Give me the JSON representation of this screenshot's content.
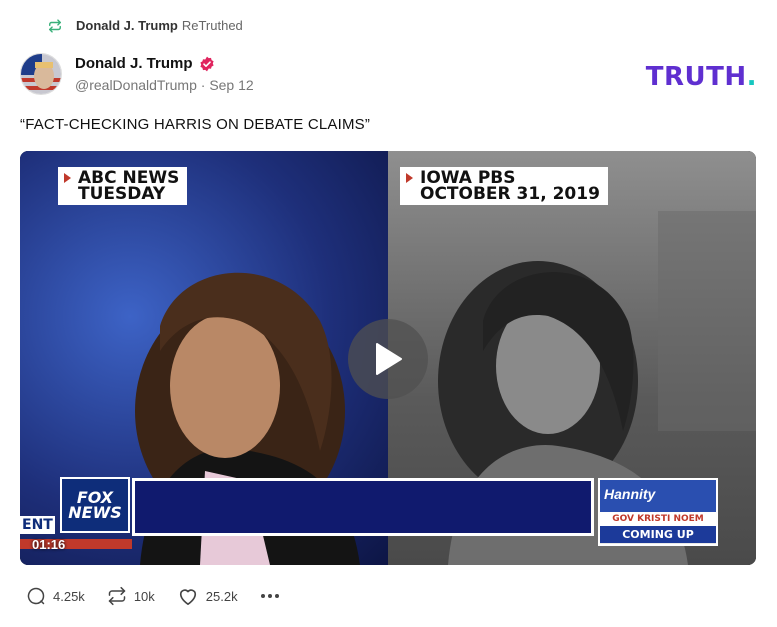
{
  "retruth": {
    "name": "Donald J. Trump",
    "label": "ReTruthed"
  },
  "author": {
    "name": "Donald J. Trump",
    "handle": "@realDonaldTrump",
    "date": "Sep 12",
    "meta_separator": " · "
  },
  "brand": {
    "logo_text": "TRUTH",
    "logo_dot": ".",
    "color": "#5f2fd0",
    "dot_color": "#16c7c0"
  },
  "post": {
    "text": "“FACT-CHECKING HARRIS ON DEBATE CLAIMS”"
  },
  "video": {
    "left_caption_line1": "ABC NEWS",
    "left_caption_line2": "TUESDAY",
    "right_caption_line1": "IOWA PBS",
    "right_caption_line2": "OCTOBER 31, 2019",
    "fox_logo_line1": "FOX",
    "fox_logo_line2": "NEWS",
    "ent_tag": "ENT",
    "hannity": "Hannity",
    "hannity_sub": "GOV KRISTI NOEM",
    "hannity_coming": "COMING UP",
    "timestamp": "01:16",
    "play_icon": "play-icon"
  },
  "actions": {
    "replies": "4.25k",
    "retruths": "10k",
    "likes": "25.2k",
    "more_icon": "more-icon"
  },
  "colors": {
    "verified_badge": "#e0245e",
    "retruth_icon": "#3ab07a"
  }
}
